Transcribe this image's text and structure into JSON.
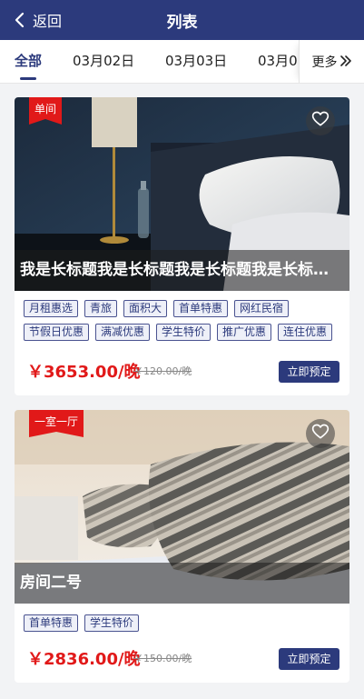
{
  "header": {
    "back_label": "返回",
    "title": "列表"
  },
  "tabs": {
    "items": [
      {
        "label": "全部",
        "active": true
      },
      {
        "label": "03月02日",
        "active": false
      },
      {
        "label": "03月03日",
        "active": false
      },
      {
        "label": "03月0",
        "active": false
      }
    ],
    "more_label": "更多"
  },
  "rooms": [
    {
      "ribbon": "单间",
      "title": "我是长标题我是长标题我是长标题我是长标题我是长标题",
      "tags": [
        "月租惠选",
        "青旅",
        "面积大",
        "首单特惠",
        "网红民宿",
        "节假日优惠",
        "满减优惠",
        "学生特价",
        "推广优惠",
        "连住优惠"
      ],
      "price": "￥3653.00/晚",
      "original_price": "￥120.00/晚",
      "book_label": "立即预定"
    },
    {
      "ribbon": "一室一厅",
      "title": "房间二号",
      "tags": [
        "首单特惠",
        "学生特价"
      ],
      "price": "￥2836.00/晚",
      "original_price": "￥150.00/晚",
      "book_label": "立即预定"
    }
  ],
  "colors": {
    "primary": "#2c3a7c",
    "accent_red": "#e11919",
    "background": "#f2f3f5"
  },
  "icons": {
    "back": "chevron-left-icon",
    "more": "double-chevron-right-icon",
    "favorite": "heart-outline-icon"
  }
}
